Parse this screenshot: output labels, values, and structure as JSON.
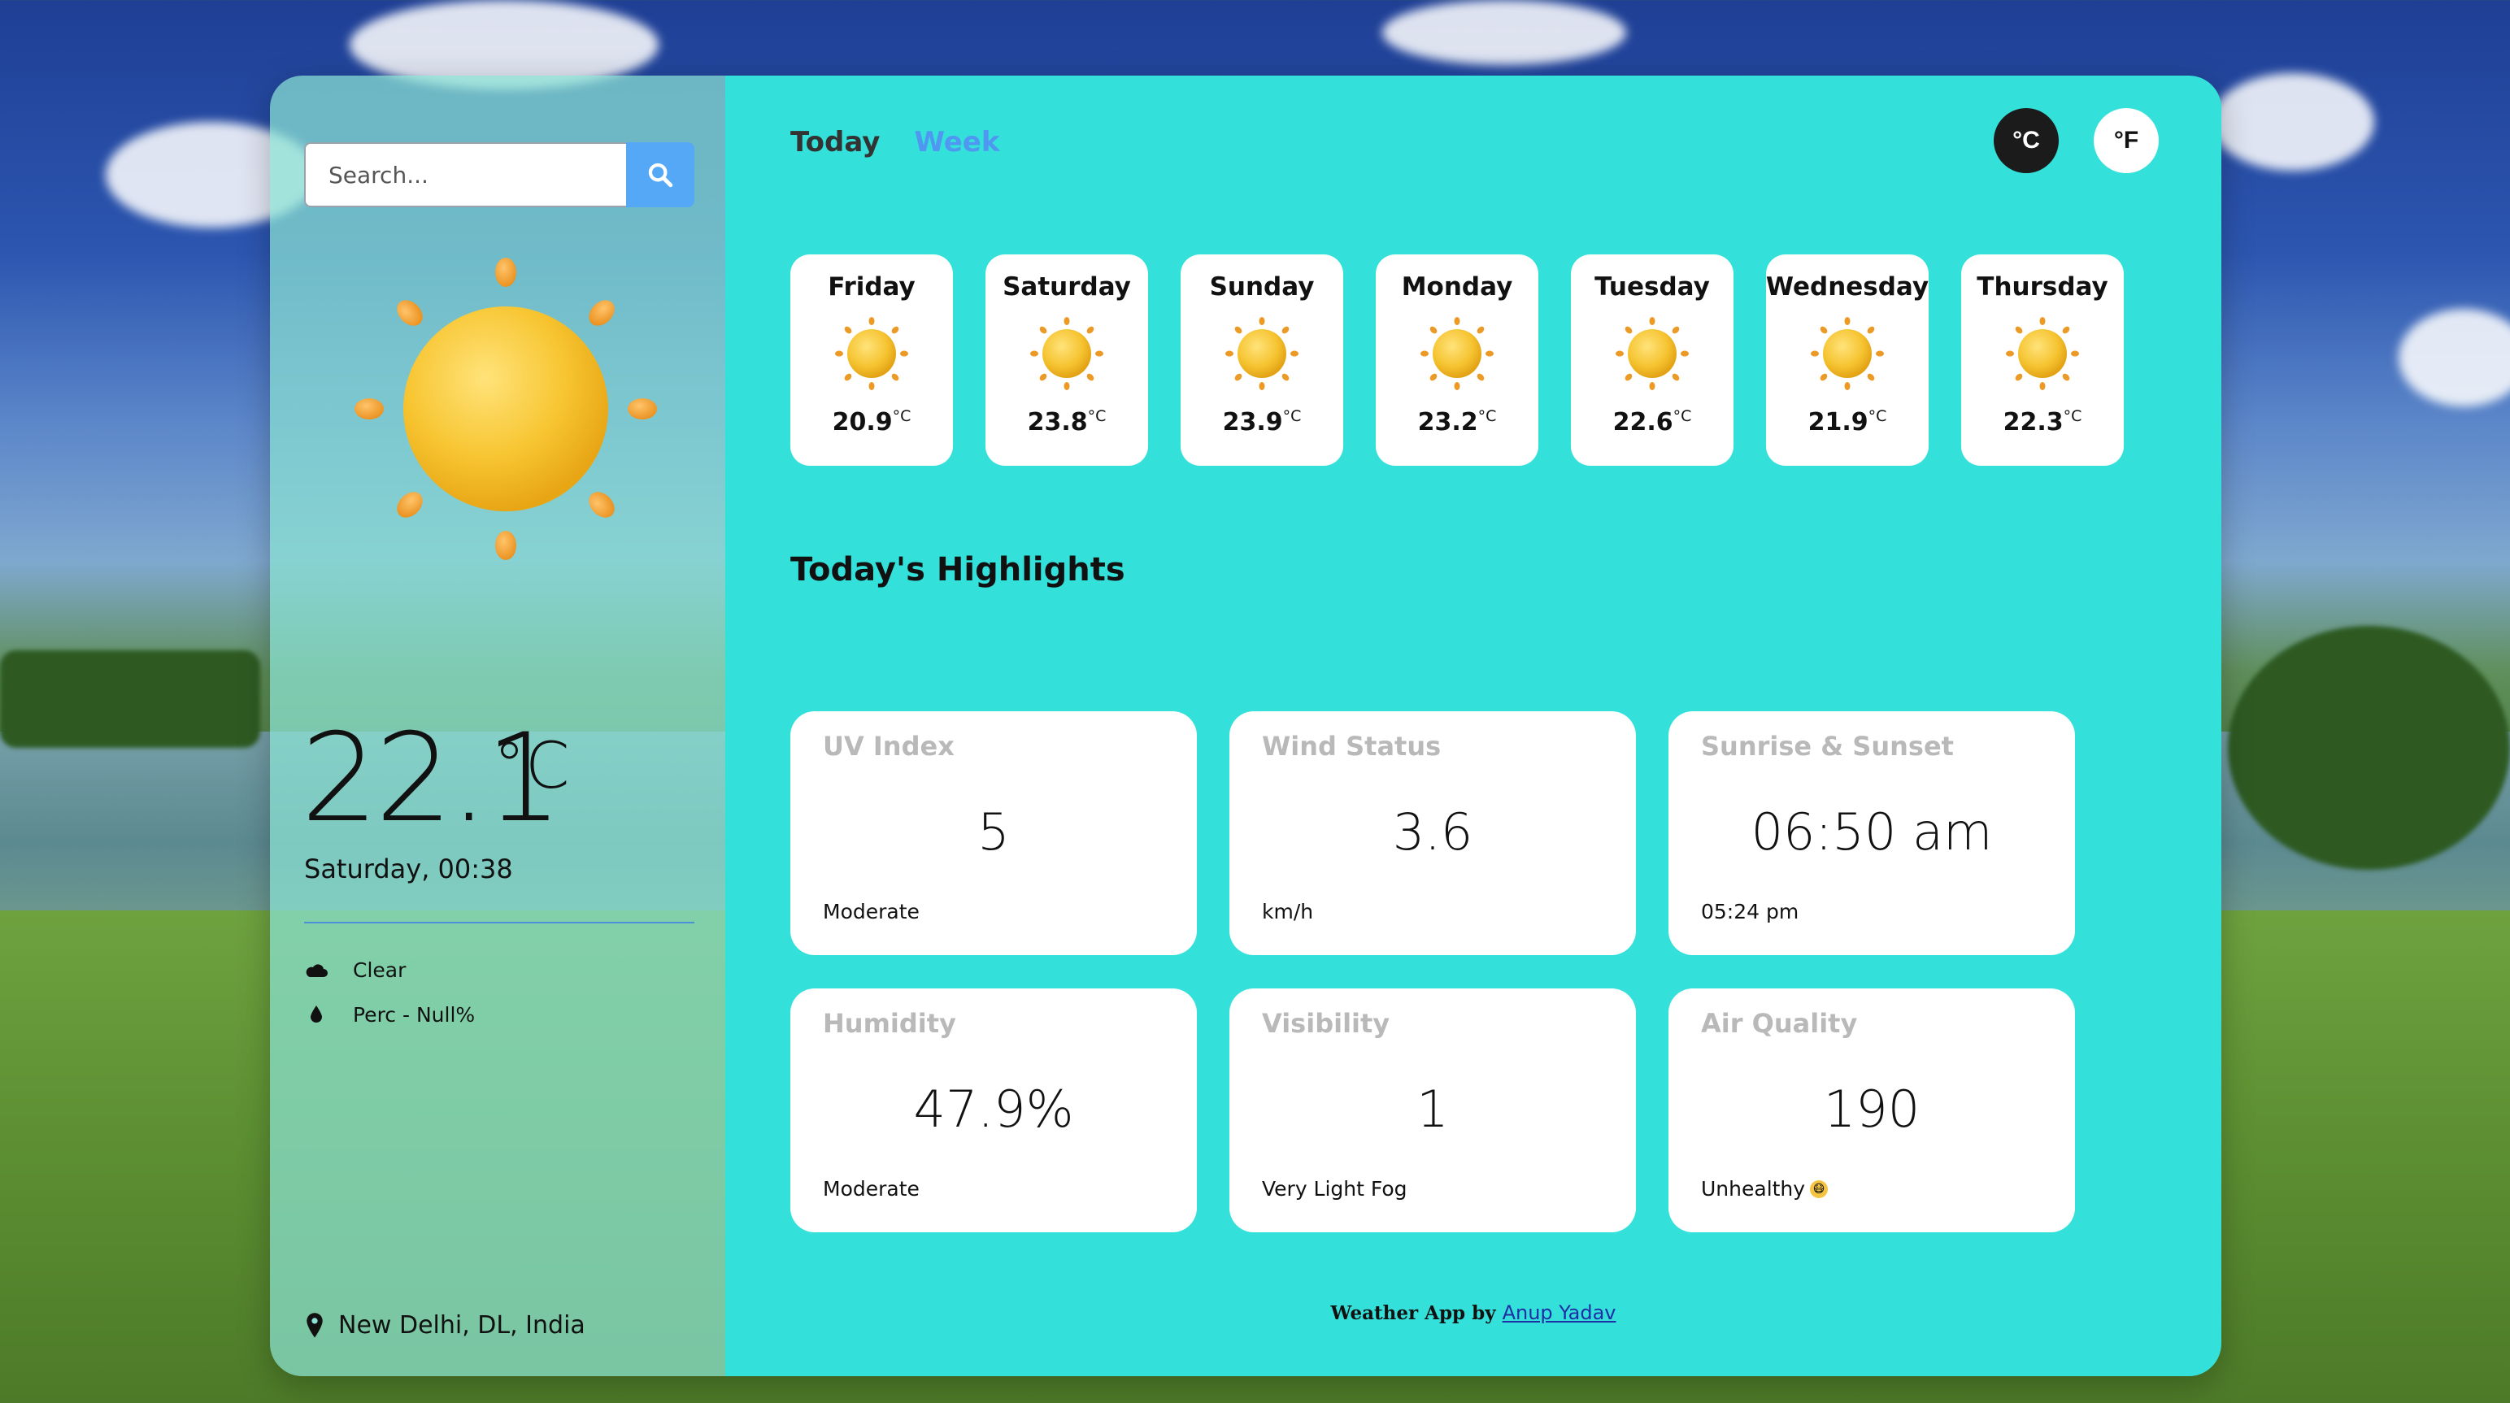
{
  "search": {
    "placeholder": "Search..."
  },
  "current": {
    "temperature": "22.1",
    "unit": "°C",
    "datetime": "Saturday, 00:38",
    "condition": "Clear",
    "precipitation": "Perc - Null%",
    "location": "New Delhi, DL, India"
  },
  "tabs": {
    "today": "Today",
    "week": "Week",
    "active": "week"
  },
  "units": {
    "celsius": "°C",
    "fahrenheit": "°F",
    "selected": "celsius"
  },
  "forecast": [
    {
      "day": "Friday",
      "temp": "20.9",
      "unit": "°C",
      "icon": "sun-icon"
    },
    {
      "day": "Saturday",
      "temp": "23.8",
      "unit": "°C",
      "icon": "sun-icon"
    },
    {
      "day": "Sunday",
      "temp": "23.9",
      "unit": "°C",
      "icon": "sun-icon"
    },
    {
      "day": "Monday",
      "temp": "23.2",
      "unit": "°C",
      "icon": "sun-icon"
    },
    {
      "day": "Tuesday",
      "temp": "22.6",
      "unit": "°C",
      "icon": "sun-icon"
    },
    {
      "day": "Wednesday",
      "temp": "21.9",
      "unit": "°C",
      "icon": "sun-icon"
    },
    {
      "day": "Thursday",
      "temp": "22.3",
      "unit": "°C",
      "icon": "sun-icon"
    }
  ],
  "highlights": {
    "title": "Today's Highlights",
    "cards": [
      {
        "title": "UV Index",
        "value": "5",
        "sub": "Moderate"
      },
      {
        "title": "Wind Status",
        "value": "3.6",
        "sub": "km/h"
      },
      {
        "title": "Sunrise & Sunset",
        "value": "06:50 am",
        "sub": "05:24 pm"
      },
      {
        "title": "Humidity",
        "value": "47.9%",
        "sub": "Moderate"
      },
      {
        "title": "Visibility",
        "value": "1",
        "sub": "Very Light Fog"
      },
      {
        "title": "Air Quality",
        "value": "190",
        "sub": "Unhealthy"
      }
    ]
  },
  "footer": {
    "text": "Weather App by",
    "author": "Anup Yadav"
  },
  "colors": {
    "main_bg": "#33e1da",
    "sidebar_bg": "#8ae2d2",
    "accent_blue": "#4f97f0",
    "search_button": "#54a8f6",
    "active_unit_bg": "#1b1b1b"
  }
}
